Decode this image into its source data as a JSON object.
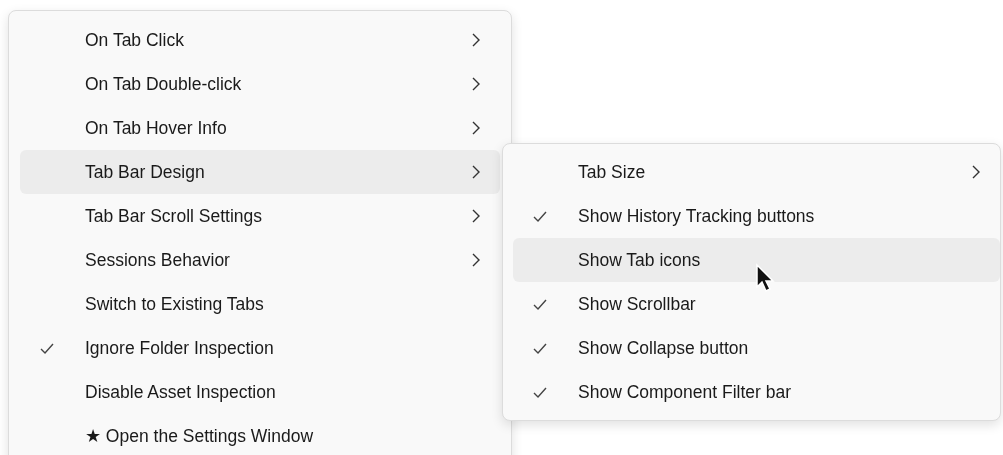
{
  "main_menu": {
    "items": [
      {
        "label": "On Tab Click",
        "submenu": true,
        "checked": false,
        "selected": false
      },
      {
        "label": "On Tab Double-click",
        "submenu": true,
        "checked": false,
        "selected": false
      },
      {
        "label": "On Tab Hover Info",
        "submenu": true,
        "checked": false,
        "selected": false
      },
      {
        "label": "Tab Bar Design",
        "submenu": true,
        "checked": false,
        "selected": true
      },
      {
        "label": "Tab Bar Scroll Settings",
        "submenu": true,
        "checked": false,
        "selected": false
      },
      {
        "label": "Sessions Behavior",
        "submenu": true,
        "checked": false,
        "selected": false
      },
      {
        "label": "Switch to Existing Tabs",
        "submenu": false,
        "checked": false,
        "selected": false
      },
      {
        "label": "Ignore Folder Inspection",
        "submenu": false,
        "checked": true,
        "selected": false
      },
      {
        "label": "Disable Asset Inspection",
        "submenu": false,
        "checked": false,
        "selected": false
      },
      {
        "label": "★ Open the Settings Window",
        "submenu": false,
        "checked": false,
        "selected": false
      }
    ]
  },
  "submenu": {
    "items": [
      {
        "label": "Tab Size",
        "submenu": true,
        "checked": false,
        "selected": false
      },
      {
        "label": "Show History Tracking buttons",
        "submenu": false,
        "checked": true,
        "selected": false
      },
      {
        "label": "Show Tab icons",
        "submenu": false,
        "checked": false,
        "selected": true
      },
      {
        "label": "Show Scrollbar",
        "submenu": false,
        "checked": true,
        "selected": false
      },
      {
        "label": "Show Collapse button",
        "submenu": false,
        "checked": true,
        "selected": false
      },
      {
        "label": "Show Component Filter bar",
        "submenu": false,
        "checked": true,
        "selected": false
      }
    ]
  }
}
